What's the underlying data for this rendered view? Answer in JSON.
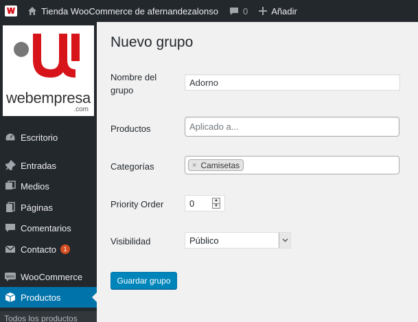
{
  "adminbar": {
    "site_name": "Tienda WooCommerce de afernandezalonso",
    "comments_count": "0",
    "new_label": "Añadir"
  },
  "logo": {
    "text": "webempresa",
    "suffix": ".com",
    "colors": {
      "red": "#d7141a",
      "gray": "#777777"
    }
  },
  "sidebar": {
    "items": [
      {
        "label": "Escritorio",
        "icon": "dashboard-icon"
      },
      {
        "label": "Entradas",
        "icon": "pin-icon"
      },
      {
        "label": "Medios",
        "icon": "media-icon"
      },
      {
        "label": "Páginas",
        "icon": "pages-icon"
      },
      {
        "label": "Comentarios",
        "icon": "comment-icon"
      },
      {
        "label": "Contacto",
        "icon": "mail-icon",
        "badge": "1"
      },
      {
        "label": "WooCommerce",
        "icon": "woo-icon"
      },
      {
        "label": "Productos",
        "icon": "box-icon",
        "active": true
      }
    ],
    "submenu_first": "Todos los productos"
  },
  "form": {
    "title": "Nuevo grupo",
    "name_label": "Nombre del grupo",
    "name_value": "Adorno",
    "products_label": "Productos",
    "products_placeholder": "Aplicado a...",
    "categories_label": "Categorías",
    "categories_tags": [
      "Camisetas"
    ],
    "priority_label": "Priority Order",
    "priority_value": "0",
    "visibility_label": "Visibilidad",
    "visibility_value": "Público",
    "save_label": "Guardar grupo"
  },
  "colors": {
    "adminbar_bg": "#23282d",
    "active_menu": "#0073aa",
    "primary_button": "#0085ba",
    "badge": "#d54e21"
  }
}
